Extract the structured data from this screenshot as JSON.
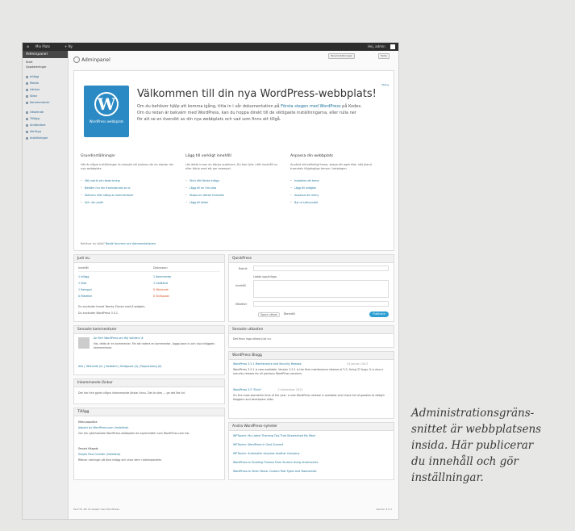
{
  "admin_bar": {
    "items": [
      "Min Plats",
      "+ Ny",
      "Hej, admin"
    ]
  },
  "sidebar": {
    "title": "Adminpanel",
    "sub": [
      "Start",
      "Uppdateringar"
    ],
    "items": [
      "Inlägg",
      "Media",
      "Länkar",
      "Sidor",
      "Kommentarer",
      "Utseende",
      "Tillägg",
      "Användare",
      "Verktyg",
      "Inställningar"
    ]
  },
  "page": {
    "title": "Adminpanel",
    "btn_screen": "Panelinställningar",
    "btn_help": "Hjälp",
    "close_link": "Stäng"
  },
  "welcome": {
    "logo_text": "WordPress webbplats",
    "title": "Välkommen till din nya WordPress-webbplats!",
    "text_before": "Om du behöver hjälp att komma igång, titta in i vår dokumentation på ",
    "text_link": "Första stegen med WordPress",
    "text_after": " på Kodex. Om du redan är bekväm med WordPress, kan du hoppa direkt till de viktigaste inställningarna, eller rulla ner för att se en översikt av din nya webbplats och vad som finns att tillgå.",
    "col1": {
      "heading": "Grundinställningar",
      "text": "Här är några inställningar du kanske vill justera när du startar din nya webbplats.",
      "items": [
        "Välj rubrik och beskrivning",
        "Bestäm hur din framsida ska se ut",
        "Aktivera eller stäng av kommentarer",
        "Fyll i din profil"
      ]
    },
    "col2": {
      "heading": "Lägg till verkligt innehåll",
      "text": "Läs detta innan du börjar publicera. Du kan fylla i ditt innehåll nu eller börja med ett par exempel.",
      "items": [
        "Skriv ditt första inlägg",
        "Lägg till en Om-sida",
        "Skapa en statisk framsida",
        "Lägg till bilder"
      ]
    },
    "col3": {
      "heading": "Anpassa din webbplats",
      "text": "Använd ett befintligt tema, skapa ett eget eller välj bland tusentals tillgängliga teman i katalogen.",
      "items": [
        "Installera ett tema",
        "Lägg till widgets",
        "Anpassa din meny",
        "Byt ut sidhuvudet"
      ]
    },
    "footer_text": "Behöver du hjälp? ",
    "footer_link": "Besök forumen och dokumentationen."
  },
  "right_now": {
    "title": "Just nu",
    "col_content": "Innehåll",
    "col_discussion": "Diskussion",
    "content_rows": [
      "1 Inlägg",
      "1 Sida",
      "1 Kategori",
      "0 Etiketter"
    ],
    "discussion_rows": [
      "1 Kommentar",
      "1 Godkänd",
      "0 Väntande",
      "0 Skräppost"
    ],
    "theme_line": "Du använder temat Twenty Eleven med 6 widgets.",
    "version_line": "Du använder WordPress 3.5.1."
  },
  "recent_comments": {
    "title": "Senaste kommentarer",
    "author_line": "Av Herr WordPress om Hej världen! #",
    "text": "Hej, detta är en kommentar. För att radera en kommentar, logga bara in och visa inläggets kommentarer.",
    "actions": "Alla | Väntande (0) | Godkänd | Skräppost (0) | Papperskorg (0)"
  },
  "incoming": {
    "title": "Inkommande länkar",
    "text": "Det har inte gjorts några inkommande länkar ännu. Det är okej — ge det lite tid."
  },
  "plugins": {
    "title": "Tillägg",
    "sections": [
      {
        "label": "Mest populära",
        "name": "Jetpack by WordPress.com (Installera)",
        "desc": "Ger din självhostade WordPress-webbplats de superkrafter som WordPress.com har."
      },
      {
        "label": "Senast tillagda",
        "name": "Simple Post Counter (Installera)",
        "desc": "Räknar visningar på dina inlägg och visar dem i adminpanelen."
      }
    ]
  },
  "quickpress": {
    "title": "QuickPress",
    "title_label": "Rubrik",
    "media_label": "Ladda upp/infoga",
    "content_label": "Innehåll",
    "tags_label": "Etiketter",
    "save_draft": "Spara utkast",
    "reset": "Återställ",
    "publish": "Publicera"
  },
  "drafts": {
    "title": "Senaste utkasten",
    "text": "Det finns inga utkast just nu."
  },
  "blog": {
    "title": "WordPress Blogg",
    "entries": [
      {
        "title": "WordPress 3.5.1 Maintenance and Security Release",
        "date": "24 januari 2013",
        "text": "WordPress 3.5.1 is now available. Version 3.5.1 is the first maintenance release of 3.5, fixing 37 bugs. It is also a security release for all previous WordPress versions."
      },
      {
        "title": "WordPress 3.5 \"Elvin\"",
        "date": "11 december 2012",
        "text": "It's the most wonderful time of the year: a new WordPress release is available and chock-full of goodies to delight bloggers and developers alike."
      }
    ]
  },
  "news": {
    "title": "Andra WordPress-nyheter",
    "items": [
      "WPTavern: My Latest Theming Tips That Streamlined My Work",
      "WPTavern: WordPress in Govt Summit",
      "WPTavern: Automattic Acquires Another Company",
      "WordPress.tv: Building Themes From Scratch Using Underscores",
      "WordPress.tv: Kevin Pazza: Custom Post Types and Taxonomies"
    ]
  },
  "footer": {
    "left": "Tack för att du skapar med WordPress.",
    "right": "Version 3.5.1"
  },
  "caption": {
    "lines": [
      "Administrationsgräns-",
      "snittet är webbplatsens",
      "insida. Här publicerar",
      "du innehåll och gör",
      "inställningar."
    ]
  }
}
